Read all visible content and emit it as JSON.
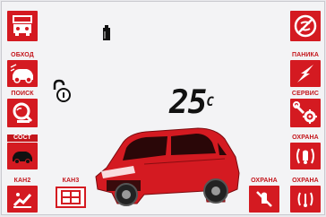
{
  "left_panel": {
    "bypass_label": "ОБХОД",
    "search_label": "ПОИСК",
    "state_label": "СОСТ",
    "channel2_label": "КАН2",
    "channel3_label": "КАН3"
  },
  "right_panel": {
    "panic_label": "ПАНИКА",
    "service_label": "СЕРВИС",
    "guard_label_1": "ОХРАНА",
    "guard_label_2": "ОХРАНА",
    "guard_label_3": "ОХРАНА"
  },
  "display": {
    "temperature": "25",
    "temperature_unit": "C"
  },
  "colors": {
    "accent": "#d41a21",
    "car": "#d41a21"
  },
  "icons": [
    "trunk-open-icon",
    "car-bypass-icon",
    "search-icon",
    "car-state-icon",
    "seat-heat-icon",
    "window-grid-icon",
    "no-engine-icon",
    "panic-icon",
    "service-gear-icon",
    "alarm-sound-icon",
    "alarm-sound-small-icon",
    "mute-siren-icon",
    "battery-icon",
    "unlock-icon"
  ]
}
